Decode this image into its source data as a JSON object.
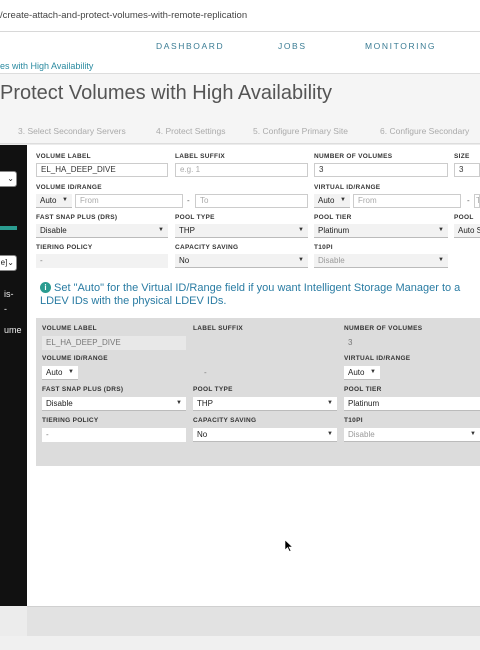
{
  "browser": {
    "url": "/create-attach-and-protect-volumes-with-remote-replication"
  },
  "nav": {
    "items": [
      "DASHBOARD",
      "JOBS",
      "MONITORING"
    ]
  },
  "breadcrumb": "es with High Availability",
  "page_title": "Protect Volumes with High Availability",
  "steps": [
    "3. Select Secondary Servers",
    "4. Protect Settings",
    "5. Configure Primary Site",
    "6. Configure Secondary"
  ],
  "sidebar": {
    "select1": "",
    "select2": "e]",
    "text1": "is-",
    "text2": "-",
    "text3": "ume"
  },
  "form": {
    "volume_label": {
      "label": "VOLUME LABEL",
      "value": "EL_HA_DEEP_DIVE"
    },
    "label_suffix": {
      "label": "LABEL SUFFIX",
      "placeholder": "e.g. 1"
    },
    "number_of_volumes": {
      "label": "NUMBER OF VOLUMES",
      "value": "3"
    },
    "size": {
      "label": "SIZE",
      "value": "3"
    },
    "volume_id_range": {
      "label": "VOLUME ID/RANGE",
      "mode": "Auto",
      "from": "From",
      "to": "To",
      "dash": "-"
    },
    "virtual_id_range": {
      "label": "VIRTUAL ID/RANGE",
      "mode": "Auto",
      "from": "From",
      "to": "T",
      "dash": "-"
    },
    "fast_snap": {
      "label": "FAST SNAP PLUS (DRS)",
      "value": "Disable"
    },
    "pool_type": {
      "label": "POOL TYPE",
      "value": "THP"
    },
    "pool_tier": {
      "label": "POOL TIER",
      "value": "Platinum"
    },
    "pool": {
      "label": "POOL",
      "value": "Auto S"
    },
    "tiering_policy": {
      "label": "TIERING POLICY",
      "value": "-"
    },
    "capacity_saving": {
      "label": "CAPACITY SAVING",
      "value": "No"
    },
    "t10pi": {
      "label": "T10PI",
      "value": "Disable"
    }
  },
  "info_text_line1": "Set \"Auto\" for the Virtual ID/Range field if you want Intelligent Storage Manager to a",
  "info_text_line2": "LDEV IDs with the physical LDEV IDs.",
  "secondary": {
    "volume_label": {
      "label": "VOLUME LABEL",
      "value": "EL_HA_DEEP_DIVE"
    },
    "label_suffix": {
      "label": "LABEL SUFFIX"
    },
    "number_of_volumes": {
      "label": "NUMBER OF VOLUMES",
      "value": "3"
    },
    "volume_id_range": {
      "label": "VOLUME ID/RANGE",
      "mode": "Auto",
      "value": "-"
    },
    "virtual_id_range": {
      "label": "VIRTUAL ID/RANGE",
      "mode": "Auto"
    },
    "fast_snap": {
      "label": "FAST SNAP PLUS (DRS)",
      "value": "Disable"
    },
    "pool_type": {
      "label": "POOL TYPE",
      "value": "THP"
    },
    "pool_tier": {
      "label": "POOL TIER",
      "value": "Platinum"
    },
    "tiering_policy": {
      "label": "TIERING POLICY",
      "value": "-"
    },
    "capacity_saving": {
      "label": "CAPACITY SAVING",
      "value": "No"
    },
    "t10pi": {
      "label": "T10PI",
      "value": "Disable"
    }
  },
  "colors": {
    "accent": "#2a7ca3",
    "nav": "#3a7c94",
    "teal": "#2a9c90",
    "sidebar": "#111111"
  }
}
